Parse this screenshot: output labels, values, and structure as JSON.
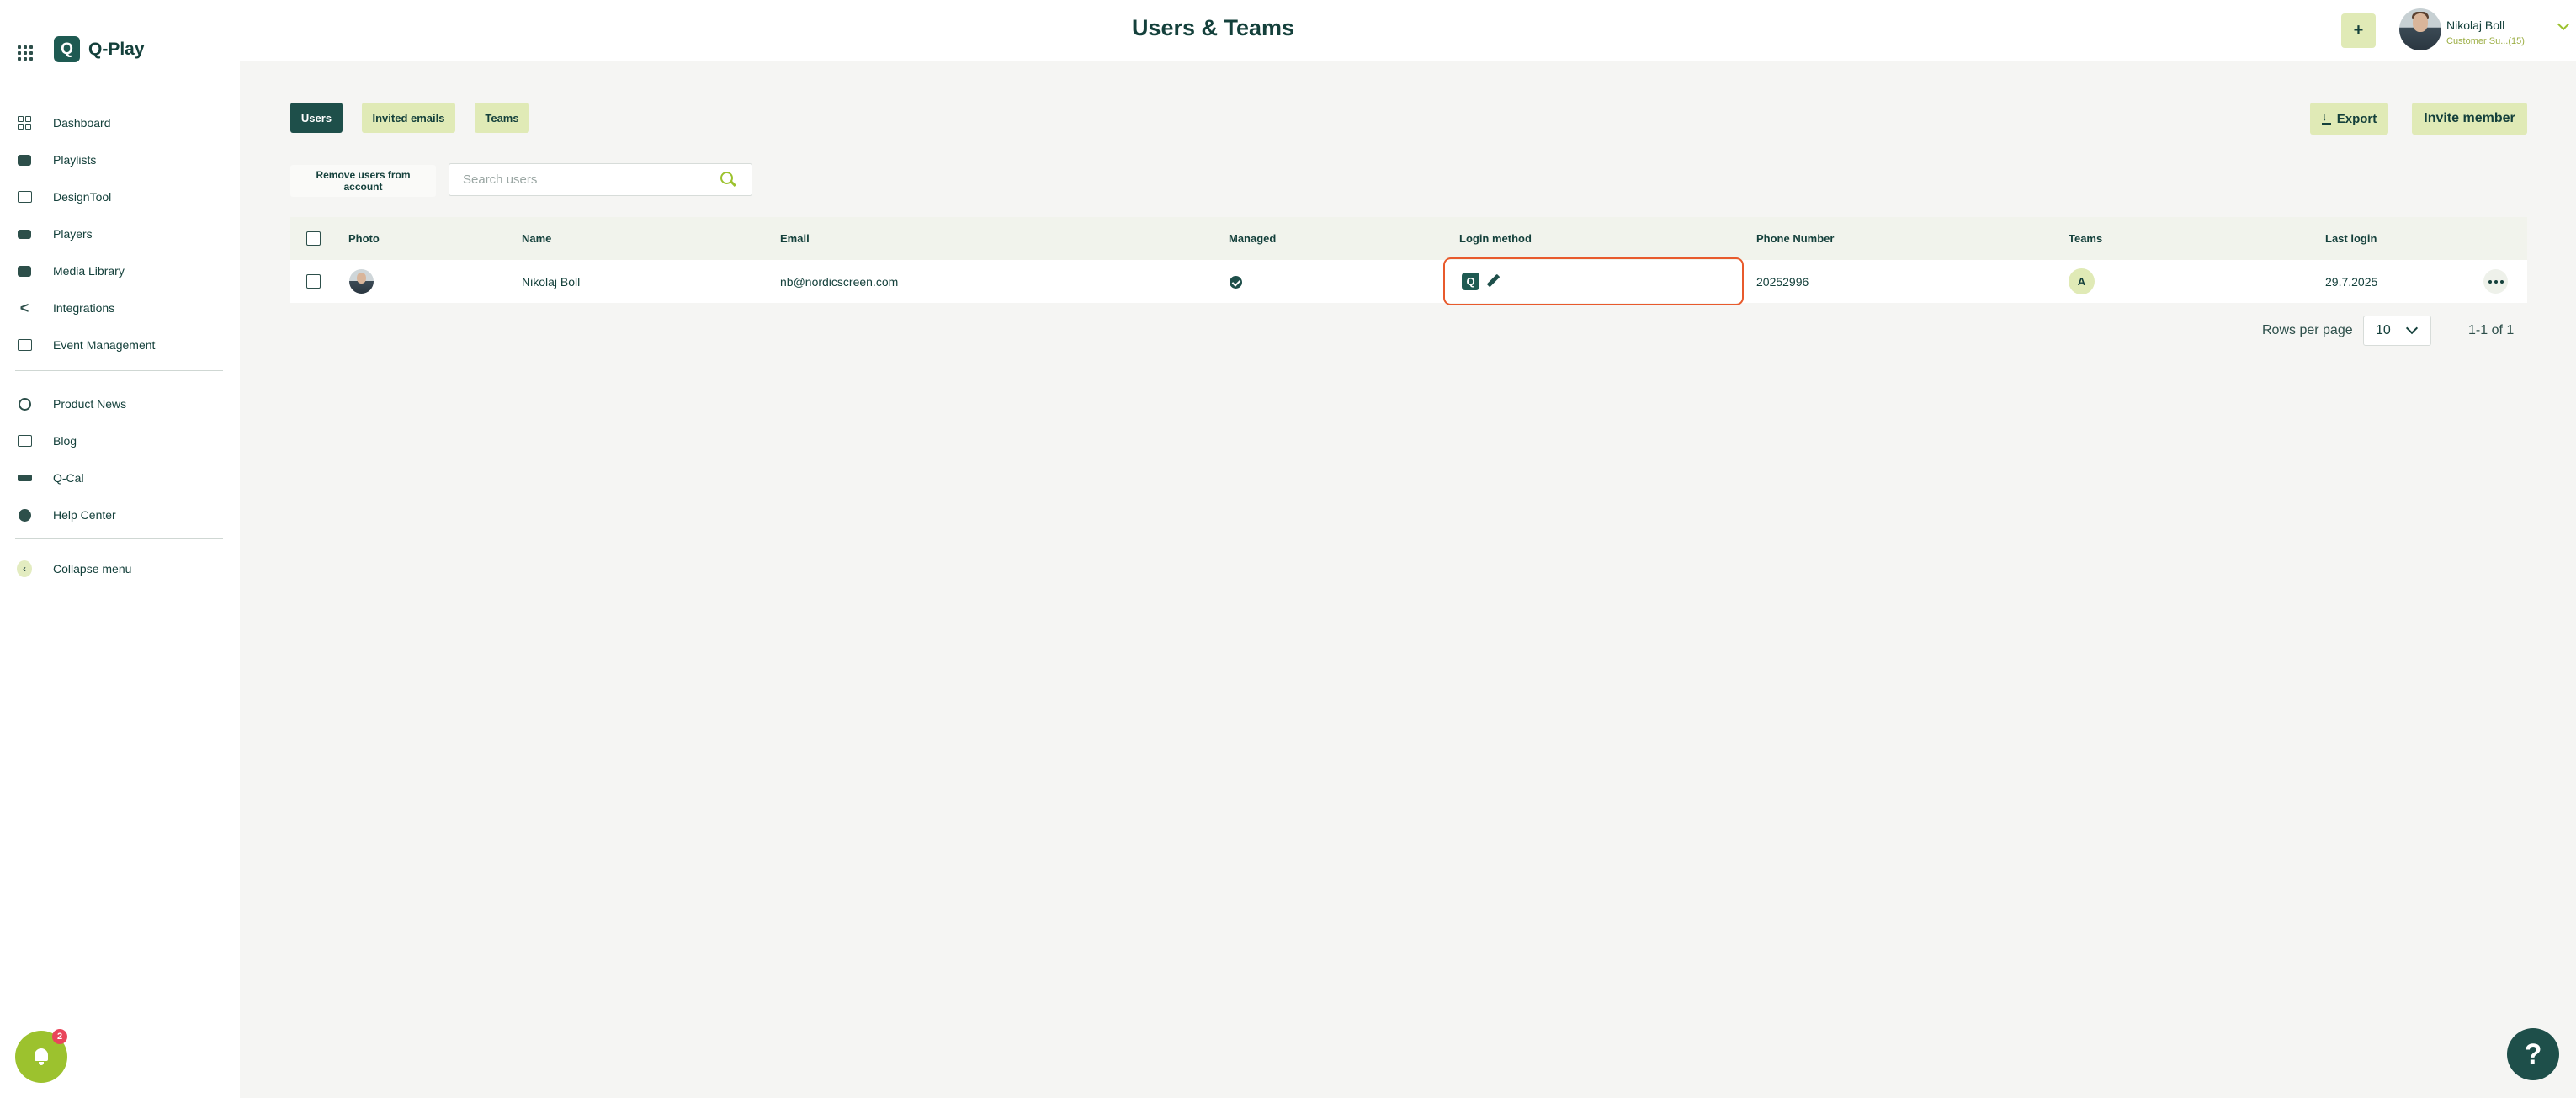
{
  "app": {
    "logo_text": "Q-Play",
    "logo_mark": "Q"
  },
  "header": {
    "title": "Users & Teams",
    "plus_label": "+",
    "user_name": "Nikolaj Boll",
    "user_role": "Customer Su...(15)"
  },
  "sidebar": {
    "items": [
      {
        "label": "Dashboard",
        "icon": "dashboard-icon"
      },
      {
        "label": "Playlists",
        "icon": "playlists-icon"
      },
      {
        "label": "DesignTool",
        "icon": "designtool-icon"
      },
      {
        "label": "Players",
        "icon": "players-icon"
      },
      {
        "label": "Media Library",
        "icon": "media-library-icon"
      },
      {
        "label": "Integrations",
        "icon": "integrations-icon"
      },
      {
        "label": "Event Management",
        "icon": "event-management-icon"
      }
    ],
    "secondary_items": [
      {
        "label": "Product News",
        "icon": "product-news-icon"
      },
      {
        "label": "Blog",
        "icon": "blog-icon"
      },
      {
        "label": "Q-Cal",
        "icon": "q-cal-icon"
      },
      {
        "label": "Help Center",
        "icon": "help-center-icon"
      }
    ],
    "collapse_label": "Collapse menu",
    "notification_count": "2"
  },
  "tabs": [
    {
      "label": "Users",
      "active": true
    },
    {
      "label": "Invited emails",
      "active": false
    },
    {
      "label": "Teams",
      "active": false
    }
  ],
  "actions": {
    "export_label": "Export",
    "invite_label": "Invite member",
    "remove_label": "Remove users from account"
  },
  "search": {
    "placeholder": "Search users",
    "value": ""
  },
  "table": {
    "columns": [
      "Photo",
      "Name",
      "Email",
      "Managed",
      "Login method",
      "Phone Number",
      "Teams",
      "Last login"
    ],
    "rows": [
      {
        "name": "Nikolaj Boll",
        "email": "nb@nordicscreen.com",
        "managed": true,
        "login_method_icon": "Q",
        "phone": "20252996",
        "team": "A",
        "last_login": "29.7.2025"
      }
    ]
  },
  "pagination": {
    "rows_per_page_label": "Rows per page",
    "rows_per_page": "10",
    "range": "1-1 of 1"
  },
  "help_label": "?",
  "colors": {
    "primary": "#1e4f4a",
    "accent": "#9cc22e",
    "button_bg": "#e0eab6",
    "highlight": "#e85a2c"
  }
}
